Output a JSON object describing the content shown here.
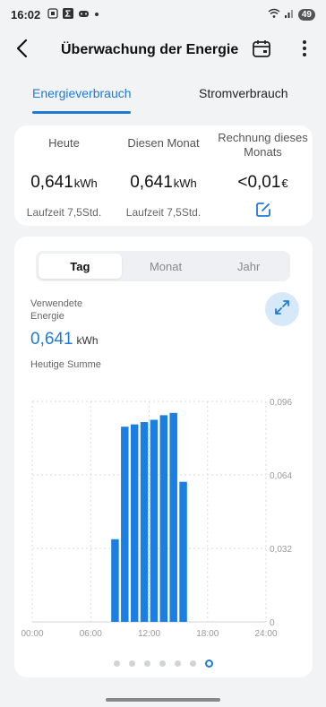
{
  "status": {
    "time": "16:02",
    "battery": "49"
  },
  "header": {
    "title": "Überwachung der Energie"
  },
  "tabs": [
    {
      "label": "Energieverbrauch"
    },
    {
      "label": "Stromverbrauch"
    }
  ],
  "summary": {
    "today": {
      "label": "Heute",
      "value": "0,641",
      "unit": "kWh",
      "sub": "Laufzeit 7,5Std."
    },
    "month": {
      "label": "Diesen Monat",
      "value": "0,641",
      "unit": "kWh",
      "sub": "Laufzeit 7,5Std."
    },
    "bill": {
      "label": "Rechnung dieses Monats",
      "value": "<0,01",
      "unit": "€"
    }
  },
  "period": {
    "options": [
      "Tag",
      "Monat",
      "Jahr"
    ],
    "selected": "Tag"
  },
  "usage": {
    "label": "Verwendete Energie",
    "value": "0,641",
    "unit": "kWh",
    "caption": "Heutige Summe"
  },
  "pagination": {
    "count": 7,
    "active": 6
  },
  "colors": {
    "accent": "#1f7ad6",
    "bar": "#1a7fe0"
  },
  "chart_data": {
    "type": "bar",
    "x_ticks": [
      "00:00",
      "06:00",
      "12:00",
      "18:00",
      "24:00"
    ],
    "y_ticks": [
      "0",
      "0,032",
      "0,064",
      "0,096"
    ],
    "ylim": [
      0,
      0.096
    ],
    "xlim": [
      0,
      24
    ],
    "x": [
      8,
      9,
      10,
      11,
      12,
      13,
      14,
      15
    ],
    "values": [
      0.036,
      0.085,
      0.086,
      0.087,
      0.088,
      0.09,
      0.091,
      0.061
    ]
  }
}
